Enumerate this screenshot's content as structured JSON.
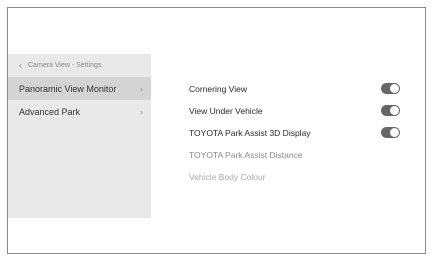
{
  "sidebar": {
    "breadcrumb": "Camera View - Settings",
    "items": [
      {
        "label": "Panoramic View Monitor",
        "active": true
      },
      {
        "label": "Advanced Park",
        "active": false
      }
    ]
  },
  "settings": [
    {
      "label": "Cornering View",
      "toggle": "on"
    },
    {
      "label": "View Under Vehicle",
      "toggle": "on"
    },
    {
      "label": "TOYOTA Park Assist 3D Display",
      "toggle": "on"
    },
    {
      "label": "TOYOTA Park Assist Distance"
    },
    {
      "label": "Vehicle Body Colour"
    }
  ],
  "colors": {
    "toggle_on": "#666666",
    "sidebar_bg": "#e9e9e9",
    "sidebar_active_bg": "#d4d4d4"
  }
}
